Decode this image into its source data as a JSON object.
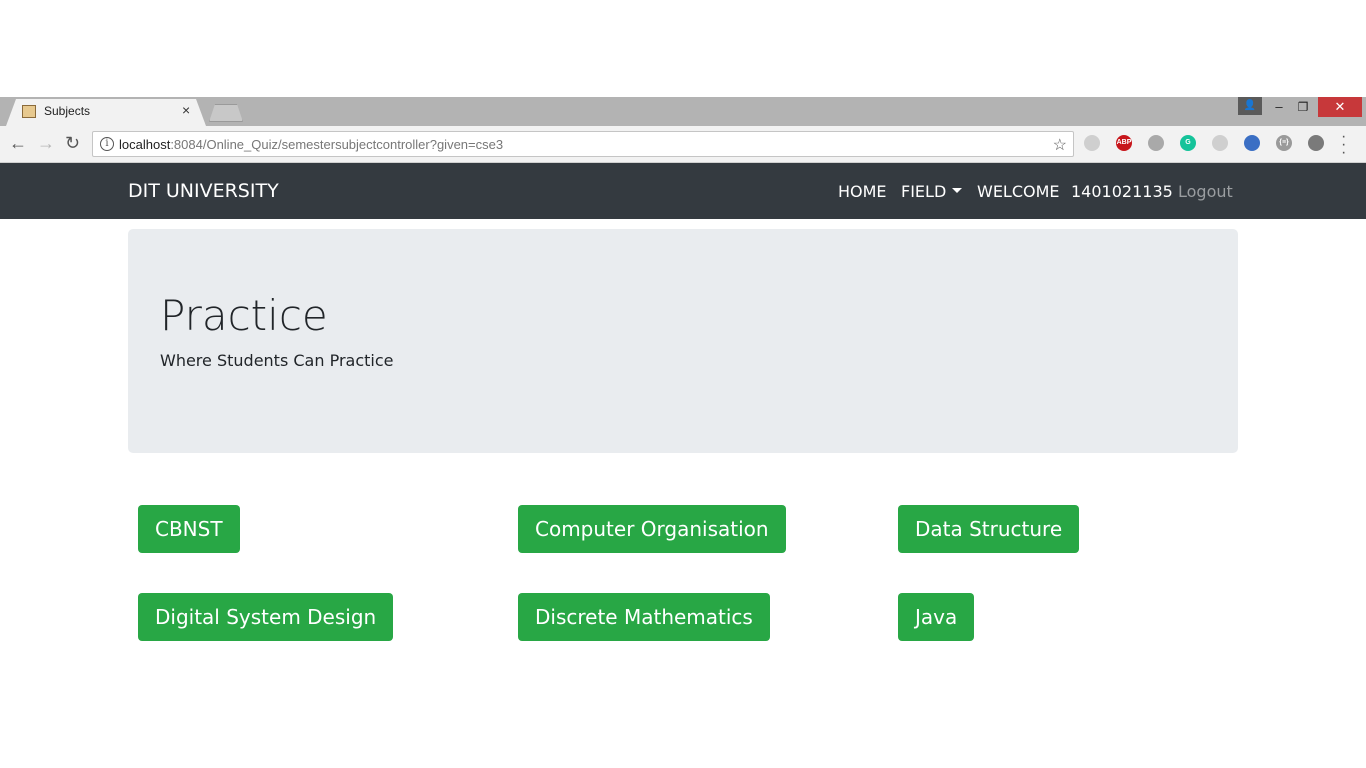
{
  "browser": {
    "tab_title": "Subjects",
    "tab_close": "×",
    "url_host": "localhost",
    "url_rest": ":8084/Online_Quiz/semestersubjectcontroller?given=cse3",
    "back": "←",
    "forward": "→",
    "reload": "↻",
    "star": "☆",
    "win_user": "👤",
    "win_min": "‒",
    "win_max": "❐",
    "win_close": "✕",
    "extensions": [
      {
        "name": "extension-icon",
        "color": "#cfcfcf"
      },
      {
        "name": "adblock-plus-icon",
        "label": "ABP",
        "color": "#c7161b"
      },
      {
        "name": "extension-icon",
        "color": "#a9a9a9"
      },
      {
        "name": "grammarly-icon",
        "label": "G",
        "color": "#15c39a"
      },
      {
        "name": "pdf-icon",
        "color": "#cfcfcf"
      },
      {
        "name": "cube-icon",
        "color": "#3b6fc4"
      },
      {
        "name": "json-icon",
        "label": "{≡}",
        "color": "#9a9a9a"
      },
      {
        "name": "extension-icon",
        "color": "#7a7a7a"
      }
    ]
  },
  "navbar": {
    "brand": "DIT UNIVERSITY",
    "home": "HOME",
    "field": "FIELD",
    "welcome": "WELCOME",
    "user_id": "1401021135",
    "logout": "Logout"
  },
  "jumbotron": {
    "title": "Practice",
    "subtitle": "Where Students Can Practice"
  },
  "subjects": [
    "CBNST",
    "Computer Organisation",
    "Data Structure",
    "Digital System Design",
    "Discrete Mathematics",
    "Java"
  ],
  "colors": {
    "navbar_bg": "#343a40",
    "jumbotron_bg": "#e9ecef",
    "button_success": "#28a745"
  }
}
